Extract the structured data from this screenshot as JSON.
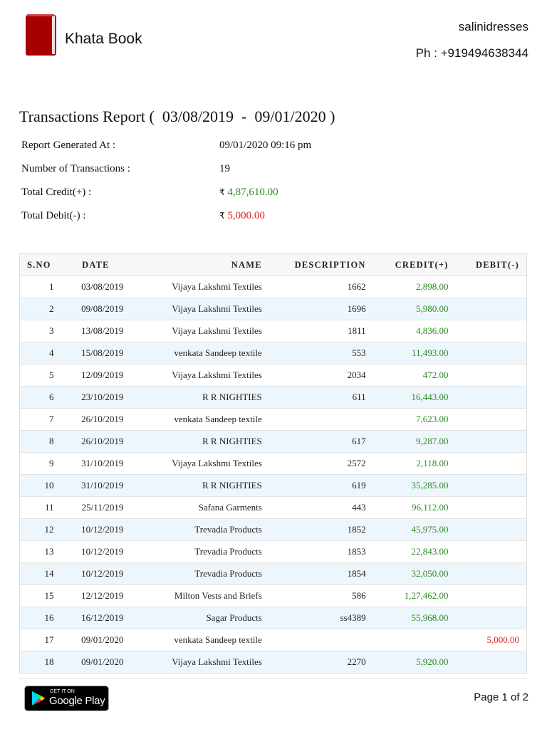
{
  "header": {
    "brand": "Khata Book",
    "shop_name": "salinidresses",
    "phone": "Ph : +919494638344"
  },
  "report": {
    "title": "Transactions Report (  03/08/2019  -  09/01/2020 )",
    "rows": [
      {
        "label": "Report Generated At :",
        "value": "09/01/2020 09:16 pm"
      },
      {
        "label": "Number of Transactions :",
        "value": "19"
      },
      {
        "label": "Total Credit(+) :",
        "currency": "₹",
        "value": "4,87,610.00"
      },
      {
        "label": "Total Debit(-) :",
        "currency": "₹",
        "value": "5,000.00"
      }
    ],
    "colors": {
      "credit": "#2e8b22",
      "debit": "#e02020"
    }
  },
  "table": {
    "headers": [
      "S.NO",
      "DATE",
      "NAME",
      "DESCRIPTION",
      "CREDIT(+)",
      "DEBIT(-)"
    ],
    "rows": [
      [
        "1",
        "03/08/2019",
        "Vijaya Lakshmi Textiles",
        "1662",
        "2,898.00",
        ""
      ],
      [
        "2",
        "09/08/2019",
        "Vijaya Lakshmi Textiles",
        "1696",
        "5,980.00",
        ""
      ],
      [
        "3",
        "13/08/2019",
        "Vijaya Lakshmi Textiles",
        "1811",
        "4,836.00",
        ""
      ],
      [
        "4",
        "15/08/2019",
        "venkata Sandeep textile",
        "553",
        "11,493.00",
        ""
      ],
      [
        "5",
        "12/09/2019",
        "Vijaya Lakshmi Textiles",
        "2034",
        "472.00",
        ""
      ],
      [
        "6",
        "23/10/2019",
        "R R NIGHTIES",
        "611",
        "16,443.00",
        ""
      ],
      [
        "7",
        "26/10/2019",
        "venkata Sandeep textile",
        "",
        "7,623.00",
        ""
      ],
      [
        "8",
        "26/10/2019",
        "R R NIGHTIES",
        "617",
        "9,287.00",
        ""
      ],
      [
        "9",
        "31/10/2019",
        "Vijaya Lakshmi Textiles",
        "2572",
        "2,118.00",
        ""
      ],
      [
        "10",
        "31/10/2019",
        "R R NIGHTIES",
        "619",
        "35,285.00",
        ""
      ],
      [
        "11",
        "25/11/2019",
        "Safana Garments",
        "443",
        "96,112.00",
        ""
      ],
      [
        "12",
        "10/12/2019",
        "Trevadia Products",
        "1852",
        "45,975.00",
        ""
      ],
      [
        "13",
        "10/12/2019",
        "Trevadia Products",
        "1853",
        "22,843.00",
        ""
      ],
      [
        "14",
        "10/12/2019",
        "Trevadia Products",
        "1854",
        "32,050.00",
        ""
      ],
      [
        "15",
        "12/12/2019",
        "Milton Vests and Briefs",
        "586",
        "1,27,462.00",
        ""
      ],
      [
        "16",
        "16/12/2019",
        "Sagar Products",
        "ss4389",
        "55,968.00",
        ""
      ],
      [
        "17",
        "09/01/2020",
        "venkata Sandeep textile",
        "",
        "",
        "5,000.00"
      ],
      [
        "18",
        "09/01/2020",
        "Vijaya Lakshmi Textiles",
        "2270",
        "5,920.00",
        ""
      ]
    ]
  },
  "footer": {
    "store_badge_small": "GET IT ON",
    "store_badge_big": "Google Play",
    "page": "Page 1 of 2"
  }
}
